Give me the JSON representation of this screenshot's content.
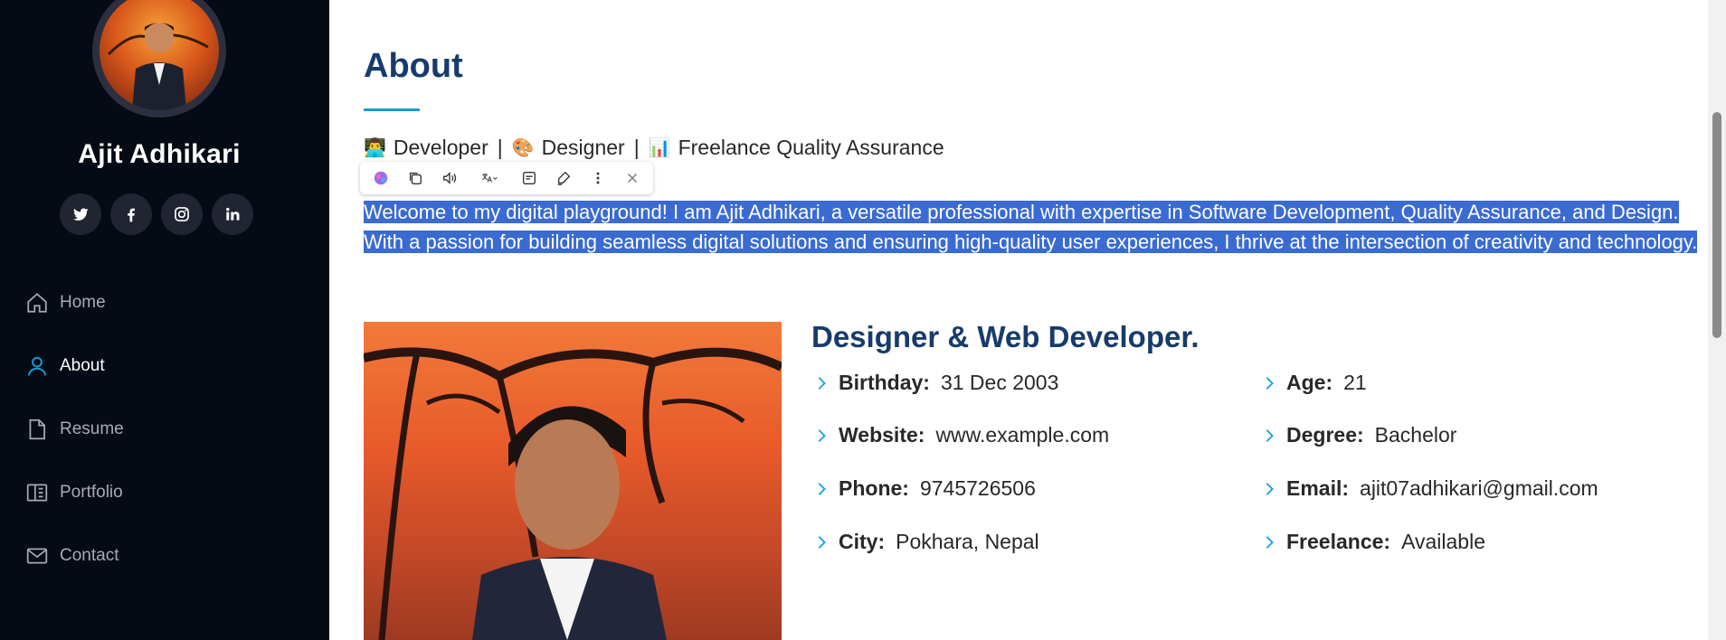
{
  "profile": {
    "name": "Ajit Adhikari"
  },
  "socials": [
    {
      "icon": "twitter-icon"
    },
    {
      "icon": "facebook-icon"
    },
    {
      "icon": "instagram-icon"
    },
    {
      "icon": "linkedin-icon"
    }
  ],
  "nav": {
    "items": [
      {
        "label": "Home",
        "icon": "home-icon"
      },
      {
        "label": "About",
        "icon": "user-icon",
        "active": true
      },
      {
        "label": "Resume",
        "icon": "file-icon"
      },
      {
        "label": "Portfolio",
        "icon": "book-icon"
      },
      {
        "label": "Contact",
        "icon": "envelope-icon"
      }
    ]
  },
  "about": {
    "title": "About",
    "roles": [
      {
        "emoji": "👨‍💻",
        "label": "Developer"
      },
      {
        "emoji": "🎨",
        "label": "Designer"
      },
      {
        "emoji": "📊",
        "label": "Freelance Quality Assurance"
      }
    ],
    "role_separator": "|",
    "intro": "Welcome to my digital playground! I am Ajit Adhikari, a versatile professional with expertise in Software Development, Quality Assurance, and Design. With a passion for building seamless digital solutions and ensuring high-quality user experiences, I thrive at the intersection of creativity and technology.",
    "subheading": "Designer & Web Developer.",
    "info_left": [
      {
        "label": "Birthday:",
        "value": "31 Dec 2003"
      },
      {
        "label": "Website:",
        "value": "www.example.com"
      },
      {
        "label": "Phone:",
        "value": "9745726506"
      },
      {
        "label": "City:",
        "value": "Pokhara, Nepal"
      }
    ],
    "info_right": [
      {
        "label": "Age:",
        "value": "21"
      },
      {
        "label": "Degree:",
        "value": "Bachelor"
      },
      {
        "label": "Email:",
        "value": "ajit07adhikari@gmail.com"
      },
      {
        "label": "Freelance:",
        "value": "Available"
      }
    ]
  },
  "selection_toolbar": {
    "buttons": [
      "ai-brain-icon",
      "copy-icon",
      "read-aloud-icon",
      "translate-icon",
      "summarize-icon",
      "highlight-icon",
      "more-icon",
      "close-icon"
    ]
  },
  "colors": {
    "sidebar_bg": "#040b14",
    "accent": "#149ddd",
    "heading": "#173b6c",
    "selection": "#3a6bd1"
  }
}
